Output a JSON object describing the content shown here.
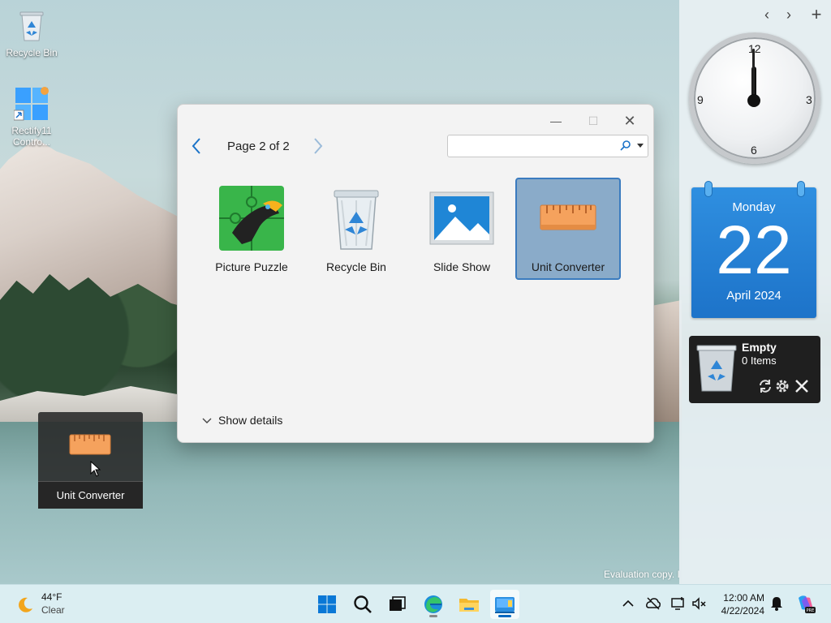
{
  "desktop": {
    "icons": [
      {
        "label": "Recycle Bin",
        "icon": "recycle-bin-icon"
      },
      {
        "label": "Rectify11 Contro...",
        "icon": "control-panel-icon"
      }
    ],
    "watermark": "Evaluation copy. I"
  },
  "sidebar": {
    "controls": {
      "prev": "‹",
      "next": "›",
      "add": "+"
    },
    "clock": {
      "numbers": [
        "12",
        "3",
        "6",
        "9"
      ],
      "hour": 12,
      "minute": 0
    },
    "calendar": {
      "weekday": "Monday",
      "day": "22",
      "month_year": "April 2024"
    },
    "recycle_gadget": {
      "title": "Empty",
      "count": "0 Items"
    }
  },
  "dialog": {
    "page_label": "Page 2 of 2",
    "search": {
      "value": "",
      "placeholder": ""
    },
    "gadgets": [
      {
        "label": "Picture Puzzle",
        "icon": "picture-puzzle-icon"
      },
      {
        "label": "Recycle Bin",
        "icon": "recycle-bin-icon"
      },
      {
        "label": "Slide Show",
        "icon": "slide-show-icon"
      },
      {
        "label": "Unit Converter",
        "icon": "unit-converter-icon",
        "selected": true
      }
    ],
    "show_details": "Show details"
  },
  "drag_ghost": {
    "label": "Unit Converter"
  },
  "taskbar": {
    "weather": {
      "temp": "44°F",
      "condition": "Clear"
    },
    "apps": [
      "start",
      "search",
      "task-view",
      "edge",
      "file-explorer",
      "gadgets"
    ],
    "time": "12:00 AM",
    "date": "4/22/2024"
  },
  "colors": {
    "accent": "#0067c0",
    "calendar_blue": "#1d73c9",
    "selection": "#8aabc9"
  }
}
